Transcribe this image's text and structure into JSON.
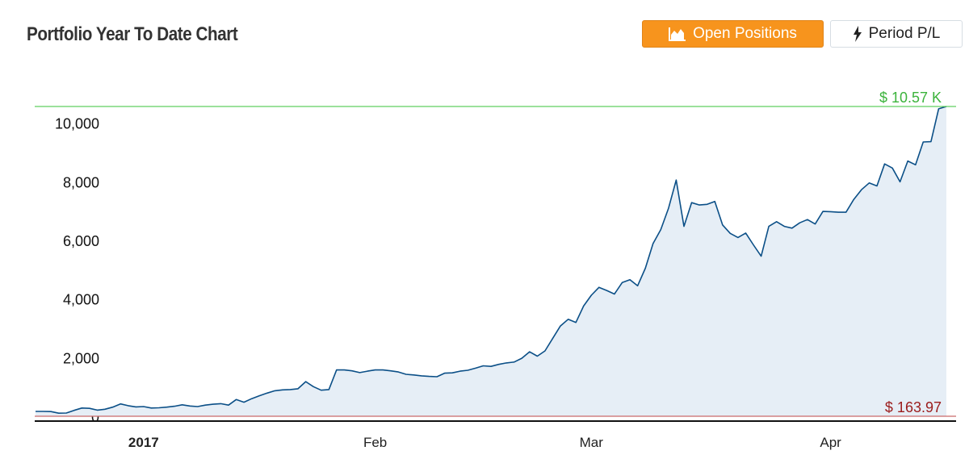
{
  "header": {
    "title": "Portfolio Year To Date Chart",
    "open_positions_label": "Open Positions",
    "period_pl_label": "Period P/L",
    "open_positions_icon": "area-chart-icon",
    "period_pl_icon": "lightning-bolt-icon"
  },
  "colors": {
    "accent": "#f7941d",
    "line": "#0b4f87",
    "fill": "#e6eef6",
    "max_line": "#5fcf5f",
    "max_label": "#3bb33b",
    "min_line": "#c96a6a",
    "min_label": "#9b1c1c"
  },
  "chart_data": {
    "type": "area",
    "ylim": [
      0,
      10570
    ],
    "yticks": [
      0,
      2000,
      4000,
      6000,
      8000,
      10000
    ],
    "ytick_labels": [
      "0",
      "2,000",
      "4,000",
      "6,000",
      "8,000",
      "10,000"
    ],
    "x_labels": [
      {
        "label": "2017",
        "x": 1,
        "bold": true
      },
      {
        "label": "Feb",
        "x": 31
      },
      {
        "label": "Mar",
        "x": 59
      },
      {
        "label": "Apr",
        "x": 90
      }
    ],
    "max_label": "$ 10.57 K",
    "min_label": "$ 163.97",
    "series": [
      {
        "x": [
          -13,
          -12,
          -11,
          -10,
          -9,
          -8,
          -7,
          -6,
          -5,
          -4,
          -3,
          -2,
          -1,
          0,
          1,
          2,
          3,
          4,
          5,
          6,
          7,
          8,
          9,
          10,
          11,
          12,
          13,
          14,
          15,
          16,
          17,
          18,
          19,
          20,
          21,
          22,
          23,
          24,
          25,
          26,
          27,
          28,
          29,
          30,
          31,
          32,
          33,
          34,
          35,
          36,
          37,
          38,
          39,
          40,
          41,
          42,
          43,
          44,
          45,
          46,
          47,
          48,
          49,
          50,
          51,
          52,
          53,
          54,
          55,
          56,
          57,
          58,
          59,
          60,
          61,
          62,
          63,
          64,
          65,
          66,
          67,
          68,
          69,
          70,
          71,
          72,
          73,
          74,
          75,
          76,
          77,
          78,
          79,
          80,
          81,
          82,
          83,
          84,
          85,
          86,
          87,
          88,
          89,
          90,
          91,
          92,
          93,
          94,
          95,
          96,
          97,
          98,
          99,
          100,
          101,
          102,
          103,
          104,
          105
        ],
        "values": [
          164,
          164,
          160,
          105,
          110,
          200,
          280,
          270,
          210,
          240,
          310,
          420,
          360,
          320,
          330,
          280,
          290,
          310,
          340,
          390,
          350,
          330,
          380,
          410,
          430,
          380,
          570,
          480,
          600,
          700,
          790,
          870,
          900,
          910,
          940,
          1180,
          1010,
          890,
          910,
          1580,
          1580,
          1550,
          1490,
          1540,
          1580,
          1580,
          1550,
          1510,
          1430,
          1410,
          1380,
          1360,
          1350,
          1470,
          1480,
          1540,
          1570,
          1640,
          1720,
          1700,
          1770,
          1820,
          1850,
          1980,
          2200,
          2050,
          2230,
          2660,
          3080,
          3310,
          3200,
          3760,
          4130,
          4400,
          4290,
          4170,
          4560,
          4660,
          4450,
          5050,
          5890,
          6370,
          7100,
          8060,
          6480,
          7290,
          7210,
          7230,
          7330,
          6530,
          6240,
          6100,
          6250,
          5850,
          5460,
          6480,
          6640,
          6480,
          6420,
          6600,
          6710,
          6560,
          6990,
          6980,
          6960,
          6960,
          7400,
          7730,
          7960,
          7860,
          8610,
          8470,
          8000,
          8710,
          8580,
          9360,
          9370,
          10490,
          10570
        ]
      }
    ]
  }
}
